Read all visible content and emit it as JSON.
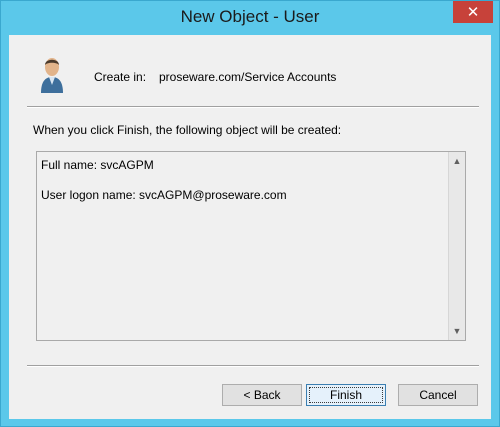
{
  "window": {
    "title": "New Object - User",
    "close_glyph": "✕"
  },
  "header": {
    "create_in_label": "Create in:",
    "create_in_path": "proseware.com/Service Accounts",
    "icon": "user-icon"
  },
  "info_text": "When you click Finish, the following object will be created:",
  "summary": {
    "lines": [
      "Full name: svcAGPM",
      "User logon name: svcAGPM@proseware.com"
    ]
  },
  "scrollbar": {
    "up_glyph": "▲",
    "down_glyph": "▼"
  },
  "buttons": {
    "back": "< Back",
    "finish": "Finish",
    "cancel": "Cancel"
  },
  "colors": {
    "frame": "#5bc8ea",
    "close": "#c7423a",
    "client": "#f0f0f0"
  }
}
